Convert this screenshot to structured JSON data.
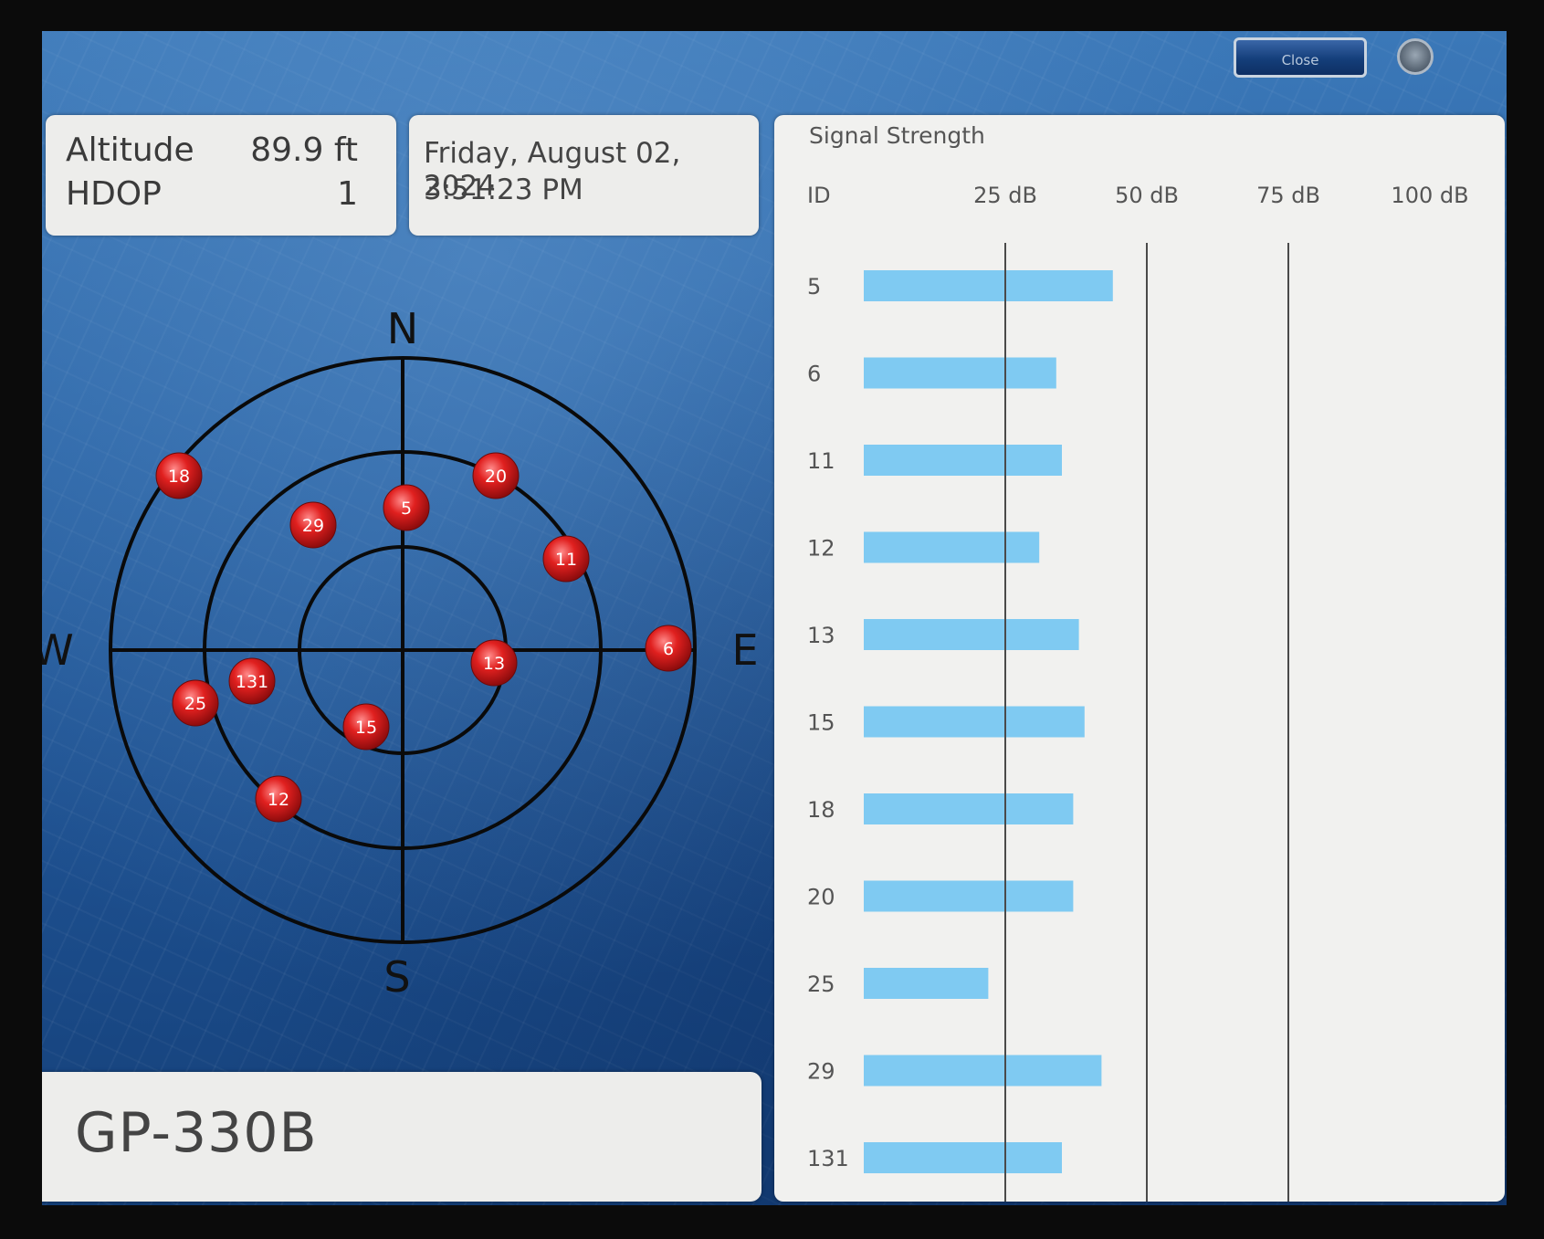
{
  "toolbar": {
    "close_label": "Close"
  },
  "status": {
    "altitude_label": "Altitude",
    "altitude_value": "89.9 ft",
    "hdop_label": "HDOP",
    "hdop_value": "1"
  },
  "clock": {
    "date": "Friday, August 02, 2024",
    "time": "3:51:23 PM"
  },
  "device": {
    "model": "GP-330B"
  },
  "skyplot": {
    "compass": {
      "north": "N",
      "south": "S",
      "east": "E",
      "west": "W"
    },
    "satellites": [
      {
        "id": "18"
      },
      {
        "id": "20"
      },
      {
        "id": "5"
      },
      {
        "id": "29"
      },
      {
        "id": "11"
      },
      {
        "id": "6"
      },
      {
        "id": "13"
      },
      {
        "id": "131"
      },
      {
        "id": "25"
      },
      {
        "id": "15"
      },
      {
        "id": "12"
      }
    ],
    "colors": {
      "sat": "#d8191c",
      "ring": "#0a0a0a"
    }
  },
  "chart_data": {
    "type": "bar",
    "title": "Signal Strength",
    "id_header": "ID",
    "orientation": "horizontal",
    "categories": [
      "5",
      "6",
      "11",
      "12",
      "13",
      "15",
      "18",
      "20",
      "25",
      "29",
      "131"
    ],
    "values": [
      44,
      34,
      35,
      31,
      38,
      39,
      37,
      37,
      22,
      42,
      35
    ],
    "xticks": [
      "25 dB",
      "50 dB",
      "75 dB",
      "100 dB"
    ],
    "xlim": [
      0,
      100
    ],
    "bar_color": "#7fcaf2"
  }
}
